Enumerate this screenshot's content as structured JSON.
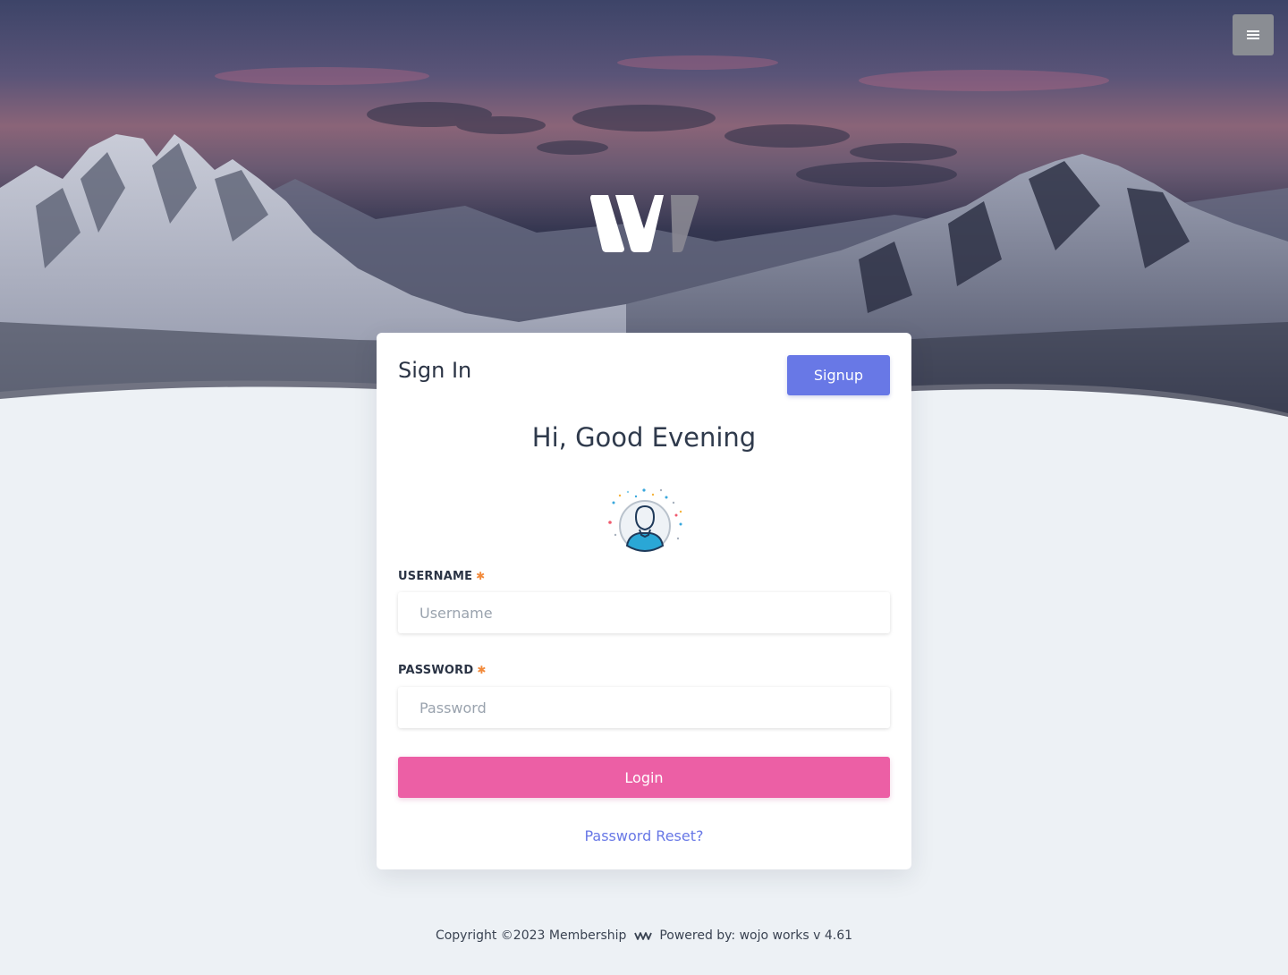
{
  "header": {
    "menu_icon": "hamburger-menu-icon",
    "logo_icon": "w-logo-icon"
  },
  "card": {
    "title": "Sign In",
    "signup_label": "Signup",
    "greeting": "Hi, Good Evening",
    "avatar_icon": "user-avatar-icon",
    "username": {
      "label": "USERNAME",
      "required_mark": "✱",
      "placeholder": "Username",
      "value": ""
    },
    "password": {
      "label": "PASSWORD",
      "required_mark": "✱",
      "placeholder": "Password",
      "value": ""
    },
    "login_label": "Login",
    "reset_label": "Password Reset?"
  },
  "footer": {
    "copyright": "Copyright ©2023 Membership",
    "powered": "Powered by: wojo works v 4.61"
  },
  "colors": {
    "signup": "#6878e6",
    "login": "#ec5fa5",
    "link": "#6878e6",
    "required": "#f28a3b",
    "page_bg": "#edf1f5"
  }
}
